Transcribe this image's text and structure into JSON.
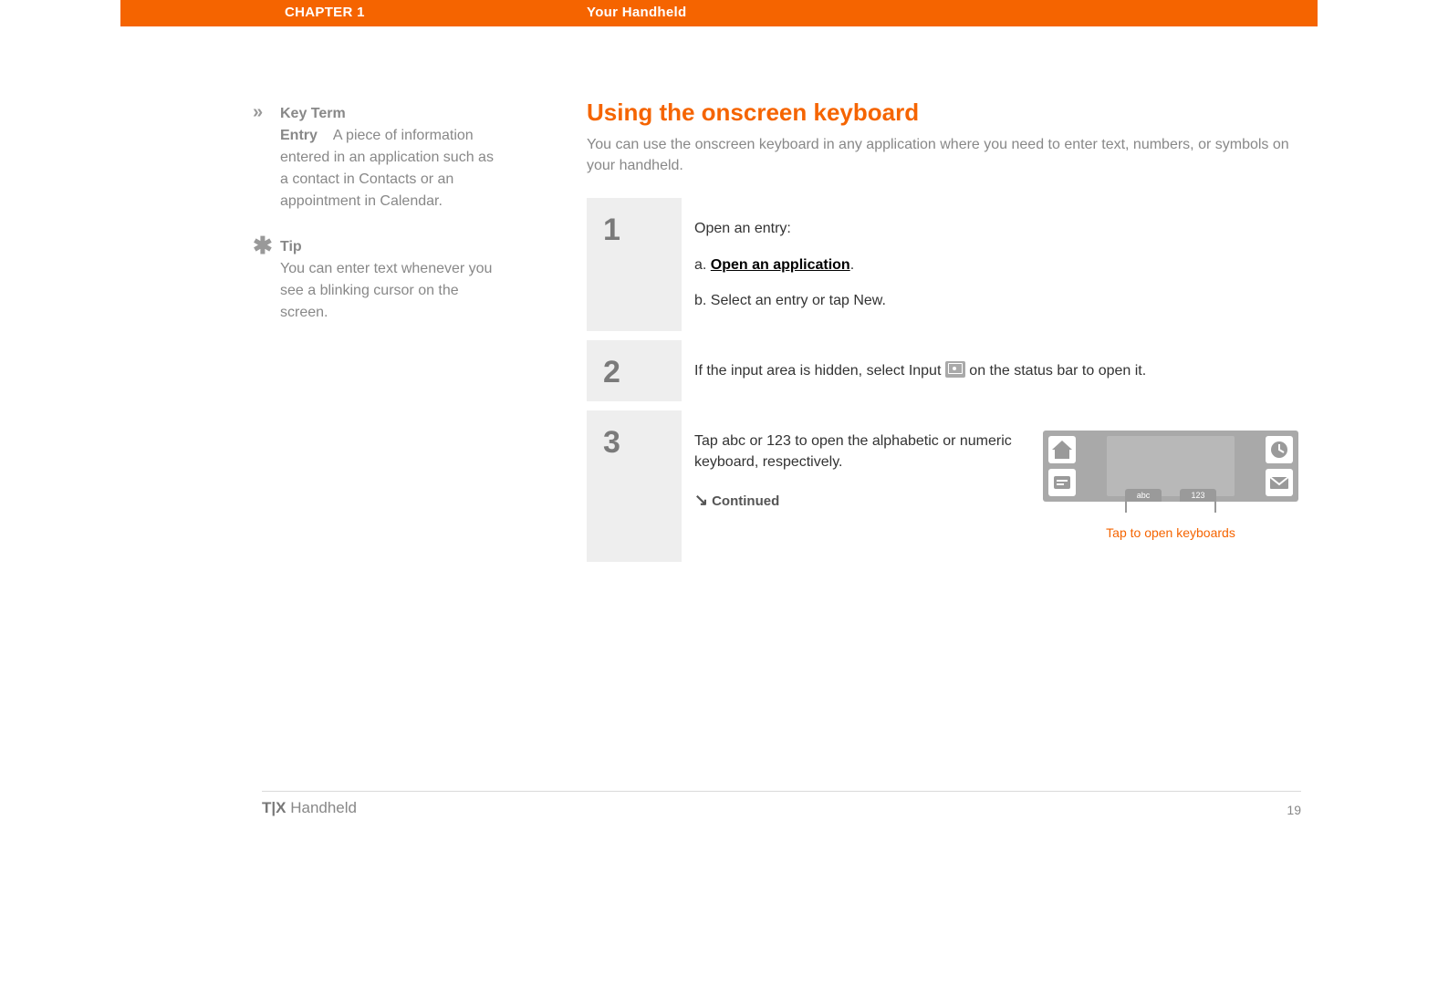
{
  "header": {
    "chapter": "CHAPTER 1",
    "section": "Your Handheld"
  },
  "sidebar": {
    "keyterm": {
      "marker": "»",
      "label": "Key Term",
      "term": "Entry",
      "definition": "A piece of information entered in an application such as a contact in Contacts or an appointment in Calendar."
    },
    "tip": {
      "marker": "✱",
      "label": "Tip",
      "text": "You can enter text whenever you see a blinking cursor on the screen."
    }
  },
  "main": {
    "title": "Using the onscreen keyboard",
    "intro": "You can use the onscreen keyboard in any application where you need to enter text, numbers, or symbols on your handheld.",
    "steps": [
      {
        "num": "1",
        "lead": "Open an entry:",
        "a_prefix": "a.  ",
        "a_link": "Open an application",
        "a_suffix": ".",
        "b": "b.  Select an entry or tap New."
      },
      {
        "num": "2",
        "text_before": "If the input area is hidden, select Input ",
        "text_after": " on the status bar to open it."
      },
      {
        "num": "3",
        "text": "Tap abc or 123 to open the alphabetic or numeric keyboard, respectively.",
        "continued_arrow": "↘",
        "continued": "Continued",
        "diagram": {
          "tab_abc": "abc",
          "tab_123": "123",
          "caption": "Tap to open keyboards"
        }
      }
    ]
  },
  "footer": {
    "product_bold": "T|X",
    "product_rest": " Handheld",
    "page": "19"
  }
}
